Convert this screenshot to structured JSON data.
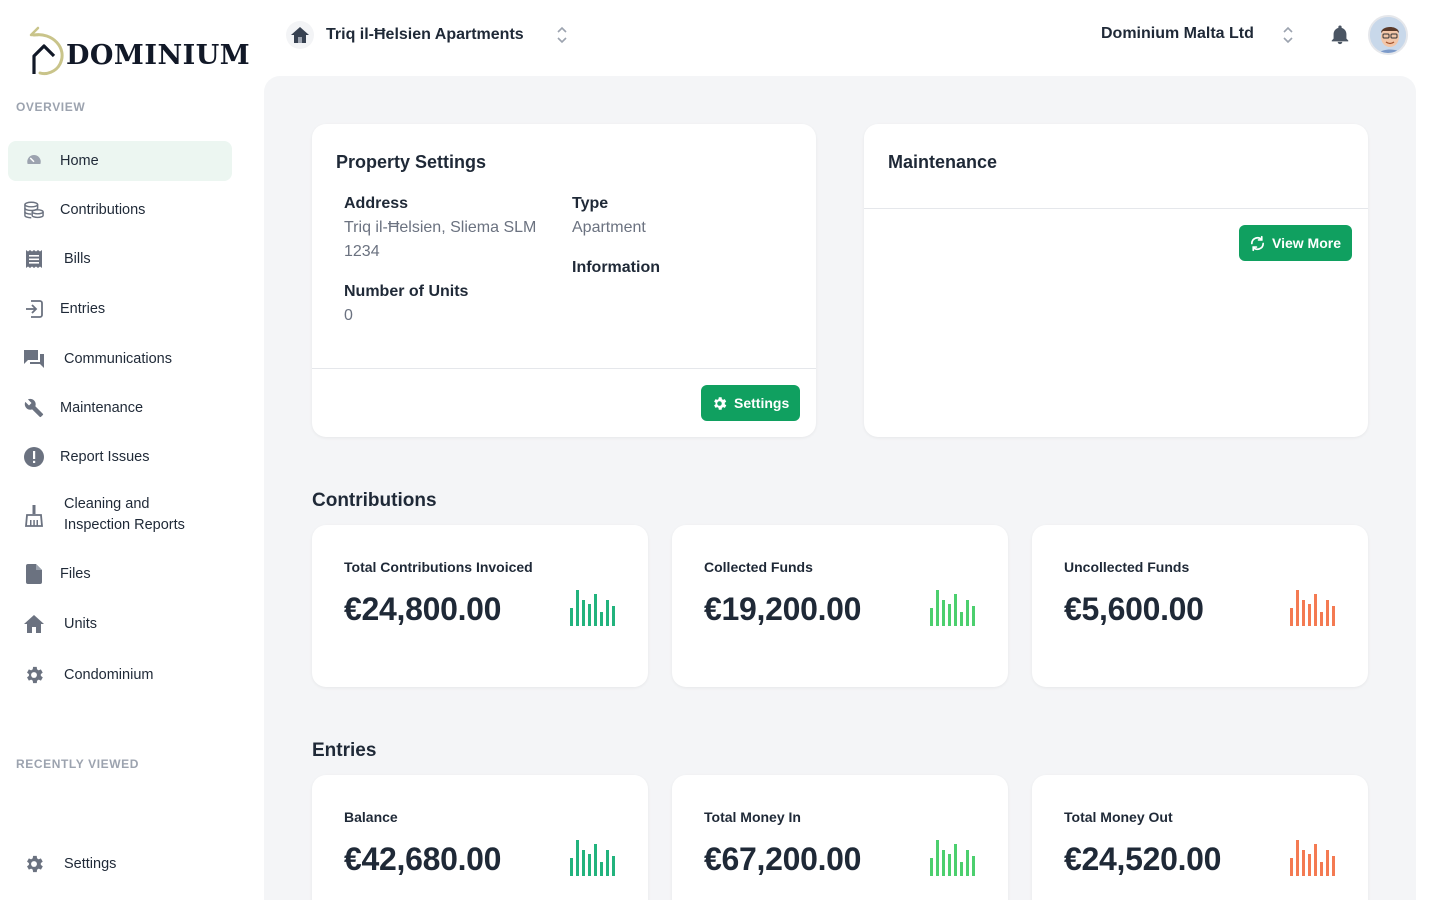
{
  "brand": {
    "name": "DOMINIUM"
  },
  "sidebar": {
    "overview_label": "OVERVIEW",
    "recent_label": "RECENTLY VIEWED",
    "items": [
      {
        "label": "Home",
        "icon": "gauge-icon"
      },
      {
        "label": "Contributions",
        "icon": "coins-icon"
      },
      {
        "label": "Bills",
        "icon": "receipt-icon"
      },
      {
        "label": "Entries",
        "icon": "entry-icon"
      },
      {
        "label": "Communications",
        "icon": "chat-icon"
      },
      {
        "label": "Maintenance",
        "icon": "wrench-icon"
      },
      {
        "label": "Report Issues",
        "icon": "alert-icon"
      },
      {
        "label": "Cleaning and",
        "label2": "Inspection Reports",
        "icon": "broom-icon"
      },
      {
        "label": "Files",
        "icon": "file-icon"
      },
      {
        "label": "Units",
        "icon": "home-icon"
      },
      {
        "label": "Condominium",
        "icon": "gear-icon"
      }
    ],
    "settings_label": "Settings"
  },
  "topbar": {
    "property": "Triq il-Ħelsien Apartments",
    "organization": "Dominium Malta Ltd"
  },
  "property_settings": {
    "title": "Property Settings",
    "address_label": "Address",
    "address_line1": "Triq il-Ħelsien, Sliema SLM",
    "address_line2": "1234",
    "type_label": "Type",
    "type_value": "Apartment",
    "information_label": "Information",
    "units_label": "Number of Units",
    "units_value": "0",
    "settings_button": "Settings"
  },
  "maintenance": {
    "title": "Maintenance",
    "view_more_button": "View More"
  },
  "contributions": {
    "heading": "Contributions",
    "cards": [
      {
        "label": "Total Contributions Invoiced",
        "value": "€24,800.00"
      },
      {
        "label": "Collected Funds",
        "value": "€19,200.00"
      },
      {
        "label": "Uncollected Funds",
        "value": "€5,600.00"
      }
    ]
  },
  "entries": {
    "heading": "Entries",
    "cards": [
      {
        "label": "Balance",
        "value": "€42,680.00"
      },
      {
        "label": "Total Money In",
        "value": "€67,200.00"
      },
      {
        "label": "Total Money Out",
        "value": "€24,520.00"
      }
    ]
  },
  "colors": {
    "accent": "#10a060",
    "active_bg": "#ecf6f1",
    "teal_bars": "#22b37d",
    "green_bars": "#4ccf6e",
    "orange_bars": "#f47a52"
  }
}
